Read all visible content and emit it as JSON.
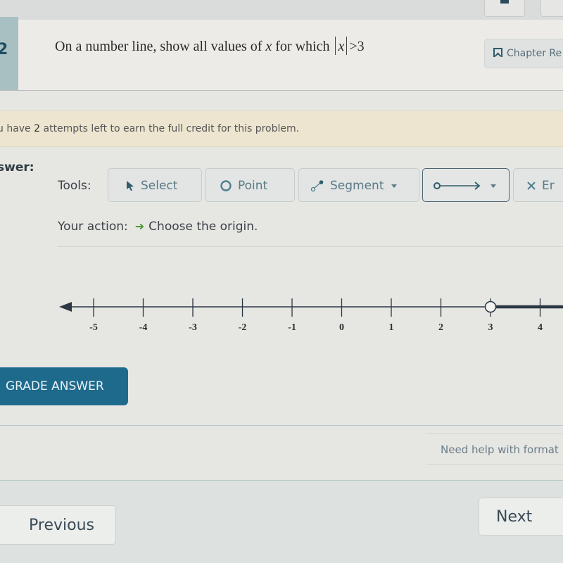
{
  "question": {
    "number": "2",
    "prefix": "On a number line, show all values of ",
    "variable": "x",
    "middle": " for which ",
    "abs_var": "x",
    "suffix": ">3"
  },
  "chapter_button": {
    "label": "Chapter Re",
    "icon": "bookmark-icon"
  },
  "attempts": {
    "before": "u have ",
    "count": "2",
    "after": " attempts left to earn the full credit for this problem."
  },
  "answer_label": "swer:",
  "tools": {
    "label": "Tools:",
    "buttons": [
      {
        "label": "Select",
        "icon": "cursor-arrow-icon"
      },
      {
        "label": "Point",
        "icon": "circle-icon"
      },
      {
        "label": "Segment",
        "icon": "segment-icon",
        "dropdown": true
      },
      {
        "label": "",
        "icon": "open-ray-icon",
        "dropdown": true,
        "active": true
      },
      {
        "label": "Er",
        "icon": "x-icon"
      }
    ]
  },
  "action": {
    "label": "Your action:",
    "text": "Choose the origin."
  },
  "number_line": {
    "min_tick": -5,
    "max_tick": 4,
    "tick_labels": [
      "-5",
      "-4",
      "-3",
      "-2",
      "-1",
      "0",
      "1",
      "2",
      "3",
      "4"
    ],
    "left_arrow": true,
    "plotted": {
      "type": "ray",
      "start": 3,
      "endpoint": "open",
      "direction": "right"
    }
  },
  "grade_button": {
    "label": "GRADE ANSWER"
  },
  "help_link": {
    "label": "Need help with format"
  },
  "nav": {
    "previous": "Previous",
    "next": "Next"
  },
  "colors": {
    "accent": "#1e6a8c",
    "tool_text": "#5a7a86",
    "action_arrow": "#4f9a3c",
    "attempts_bg": "#ede5d0",
    "line": "#2b3742"
  }
}
